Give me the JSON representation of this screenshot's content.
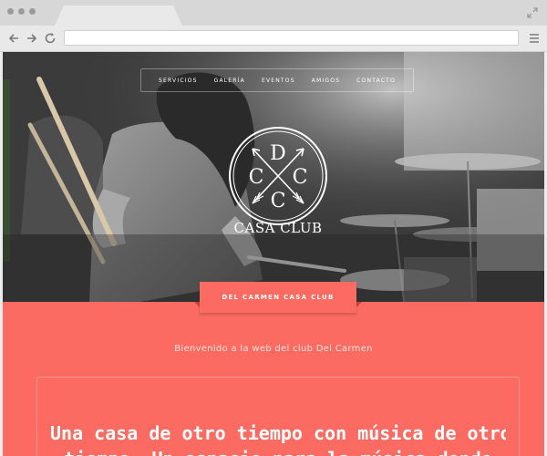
{
  "browser": {
    "icons": [
      "window-dot-icon",
      "expand-icon",
      "back-arrow-icon",
      "forward-arrow-icon",
      "reload-icon",
      "menu-icon"
    ]
  },
  "site": {
    "nav": [
      {
        "label": "SERVICIOS"
      },
      {
        "label": "GALERÍA"
      },
      {
        "label": "EVENTOS"
      },
      {
        "label": "AMIGOS"
      },
      {
        "label": "CONTACTO"
      }
    ],
    "logo": {
      "letters": [
        "D",
        "C",
        "C",
        "C"
      ],
      "name": "CASA CLUB"
    },
    "ribbon": "DEL CARMEN CASA CLUB",
    "welcome": "Bienvenido a la web del club Del Carmen",
    "heading_line1": "Una casa de otro tiempo con música de otro",
    "heading_line2": "tiempo. Un espacio para la música donde"
  },
  "colors": {
    "accent": "#fb6b62",
    "ribbon_shadow": "#c9463f",
    "chrome": "#d7d7d7"
  }
}
